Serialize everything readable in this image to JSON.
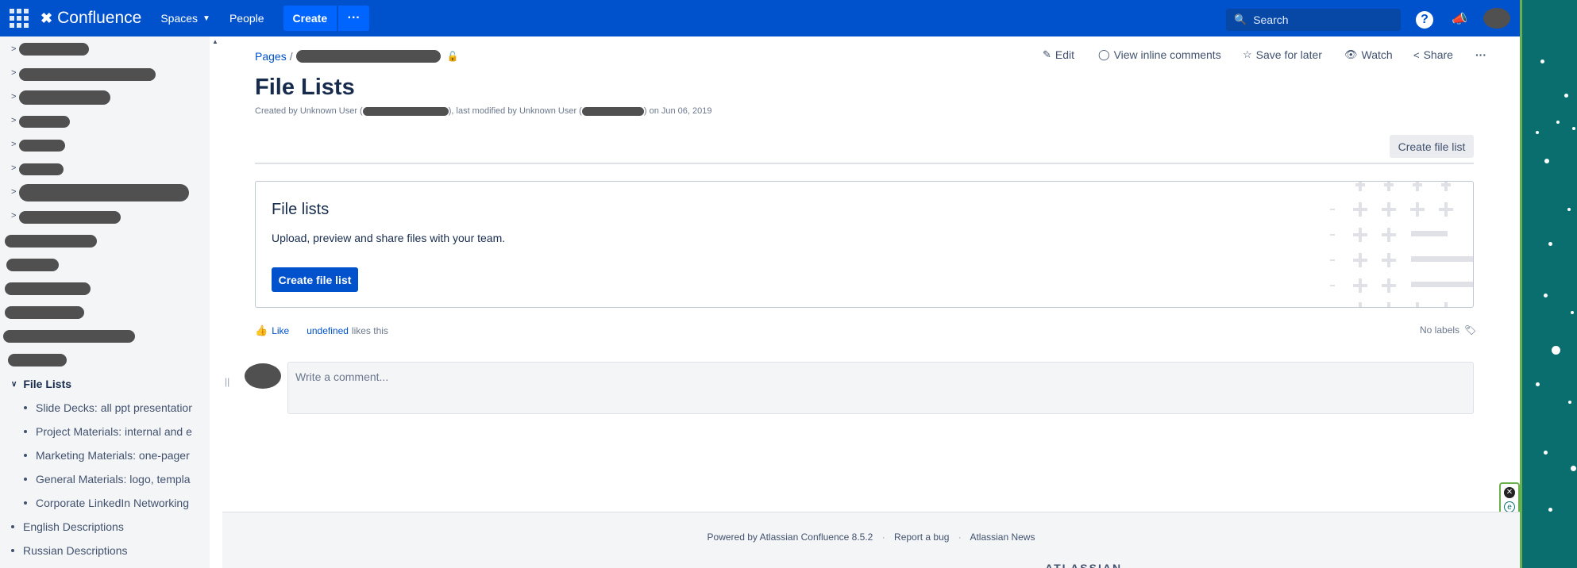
{
  "topbar": {
    "app_name": "Confluence",
    "nav": [
      "Spaces",
      "People"
    ],
    "create_label": "Create",
    "more_label": "···",
    "search_placeholder": "Search"
  },
  "sidebar": {
    "current_page": "File Lists",
    "children": [
      "Slide Decks: all ppt presentation",
      "Project Materials: internal and e",
      "Marketing Materials: one-pager",
      "General Materials: logo, templa",
      "Corporate LinkedIn Networking"
    ],
    "siblings": [
      "English Descriptions",
      "Russian Descriptions"
    ]
  },
  "breadcrumb": {
    "root": "Pages"
  },
  "page_actions": {
    "edit": "Edit",
    "inline_comments": "View inline comments",
    "save_for_later": "Save for later",
    "watch": "Watch",
    "share": "Share",
    "more": "···"
  },
  "page": {
    "title": "File Lists",
    "byline_created": "Created by Unknown User (",
    "byline_modified": "), last modified by Unknown User (",
    "byline_date": ") on Jun 06, 2019",
    "create_file_list_top": "Create file list"
  },
  "panel": {
    "title": "File lists",
    "description": "Upload, preview and share files with your team.",
    "button": "Create file list"
  },
  "likes": {
    "like": "Like",
    "undefined": "undefined",
    "likes_this": "likes this",
    "no_labels": "No labels"
  },
  "comment": {
    "placeholder": "Write a comment..."
  },
  "footer": {
    "powered": "Powered by Atlassian Confluence 8.5.2",
    "report": "Report a bug",
    "news": "Atlassian News",
    "logo": "ATLASSIAN"
  },
  "colors": {
    "nav_bg": "#0052cc",
    "accent": "#0052cc",
    "teal": "#0b6e6e"
  }
}
